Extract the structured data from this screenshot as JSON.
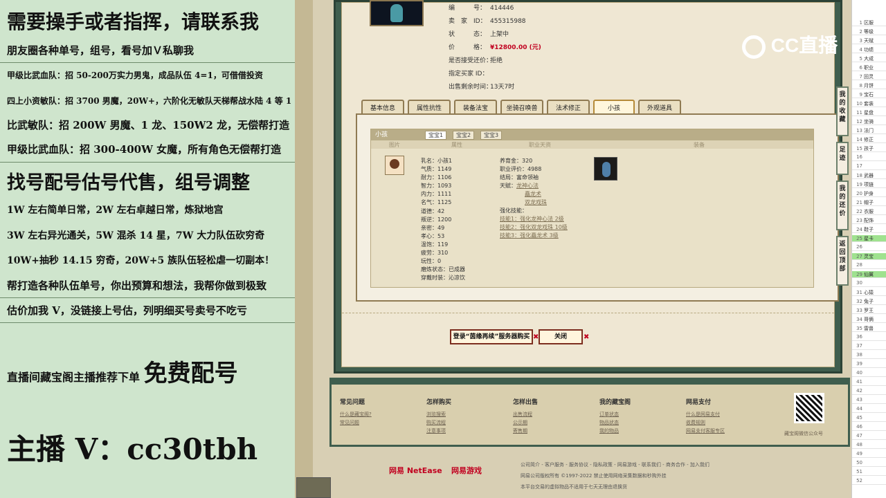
{
  "promo": {
    "l1": "需要操手或者指挥，请联系我",
    "l2": "朋友圈各种单号，组号，看号加Ｖ私聊我",
    "l3": "甲级比武血队：招 50-200万实力男鬼，成品队伍 4=1，可借借投资",
    "l4": "四上小资敏队：招 3700 男魔，20W+，六阶化无敏队天梯帮战水陆 4 等 1",
    "l5": "比武敏队：招 200W 男魔、1 龙、150W2 龙，无偿帮打造",
    "l6": "甲级比武血队：招 300-400W 女魔，所有角色无偿帮打造",
    "l7": "找号配号估号代售，组号调整",
    "l8": "1W 左右简单日常，2W 左右卓越日常，炼狱地宫",
    "l9": "3W 左右异光通关，5W 混杀 14 星，7W 大力队伍砍穷奇",
    "l10": "10W+抽秒 14.15 穷奇，20W+5 族队伍轻松虐一切副本！",
    "l11": "帮打造各种队伍单号，你出预算和想法，我帮你做到极致",
    "l12": "估价加我 V，没链接上号估，列明细买号卖号不吃亏",
    "l13a": "直播间藏宝阁主播推荐下单",
    "l13b": "免费配号",
    "l14": "主播 V：cc30tbh"
  },
  "listing": {
    "num_label": "编　　　号：",
    "num": "414446",
    "seller_label": "卖　家　ID：",
    "seller": "455315988",
    "status_label": "状　　　态：",
    "status": "上架中",
    "price_label": "价　　　格：",
    "price": "¥12800.00 (元)",
    "bargain_label": "是否接受还价：",
    "bargain": "拒绝",
    "buyer_label": "指定买家 ID：",
    "buyer": "",
    "time_label": "出售剩余时间：",
    "time": "13天7时"
  },
  "tabs": [
    "基本信息",
    "属性抗性",
    "装备法宝",
    "坐骑召唤兽",
    "法术修正",
    "小孩",
    "外观道具"
  ],
  "child_panel": {
    "title": "小孩",
    "subtabs": [
      "宝宝1",
      "宝宝2",
      "宝宝3"
    ],
    "cols": [
      "图片",
      "属性",
      "职业天资",
      "装备"
    ],
    "attrs": [
      "乳名：小孩1",
      "气质：1149",
      "耐力：1106",
      "智力：1093",
      "内力：1111",
      "名气：1125",
      "道德：42",
      "叛逆：1200",
      "亲密：49",
      "孝心：53",
      "温饱：119",
      "疲劳：310",
      "玩性：0",
      "磨炼状态：已成器",
      "穿戴时装：沁凉饮"
    ],
    "attrs2": [
      "养育金：320",
      "职业评价：4988",
      "结局：富命领袖",
      "天赋："
    ],
    "talents": [
      "龙神心法",
      "矗龙术",
      "双龙戏珠"
    ],
    "strengthen_label": "强化技能：",
    "skills": [
      "技能1：强化龙神心法 2级",
      "技能2：强化双龙戏珠 10级",
      "技能3：强化矗龙术 3级"
    ]
  },
  "buttons": {
    "login_buy": "登录“茵缘再续”服务器购买",
    "close": "关闭"
  },
  "footer": {
    "cols": [
      {
        "h": "常见问题",
        "links": [
          "什么是藏宝阁?",
          "常见问题"
        ]
      },
      {
        "h": "怎样购买",
        "links": [
          "浏览搜索",
          "购买流程",
          "注意事项"
        ]
      },
      {
        "h": "怎样出售",
        "links": [
          "出售流程",
          "公示期",
          "寄售期"
        ]
      },
      {
        "h": "我的藏宝阁",
        "links": [
          "订单状态",
          "物品状态",
          "我的物品"
        ]
      },
      {
        "h": "网易支付",
        "links": [
          "什么是网易支付",
          "收费规则",
          "网易支付客服专区"
        ]
      }
    ],
    "qr_caption": "藏宝阁微信公众号",
    "brand1": "网易 NetEase",
    "brand2": "网易游戏",
    "copy1": "公司简介 - 客户服务 - 服务协议 - 隐私政策 - 网易游戏 - 联系我们 - 商务合作 - 加入我们",
    "copy2": "网易公司版权所有 ©1997-2022 禁止使用网络采集数据和秒购外挂",
    "copy3": "本平台交易的虚拟物品不适用于七天无理由退换货"
  },
  "sidebar": [
    "我的收藏",
    "足迹",
    "我的还价",
    "返回顶部"
  ],
  "logo": "CC直播",
  "sheet_rows": [
    "区服",
    "等级",
    "天赋",
    "功绩",
    "大成",
    "职业",
    "回灵",
    "月饼",
    "宝石",
    "套装",
    "星盘",
    "坐骑",
    "法门",
    "修正",
    "孩子",
    "",
    "",
    "武器",
    "项链",
    "护身",
    "帽子",
    "衣服",
    "配饰",
    "鞋子",
    "星卡",
    "",
    "灵宝",
    "",
    "仙翼",
    "",
    "心猿",
    "兔子",
    "罗王",
    "哥俩",
    "雷兽"
  ],
  "colors": {
    "accent_red": "#c1001f",
    "dialog_green": "#3f5e4e",
    "promo_bg": "#cfe5cd"
  }
}
